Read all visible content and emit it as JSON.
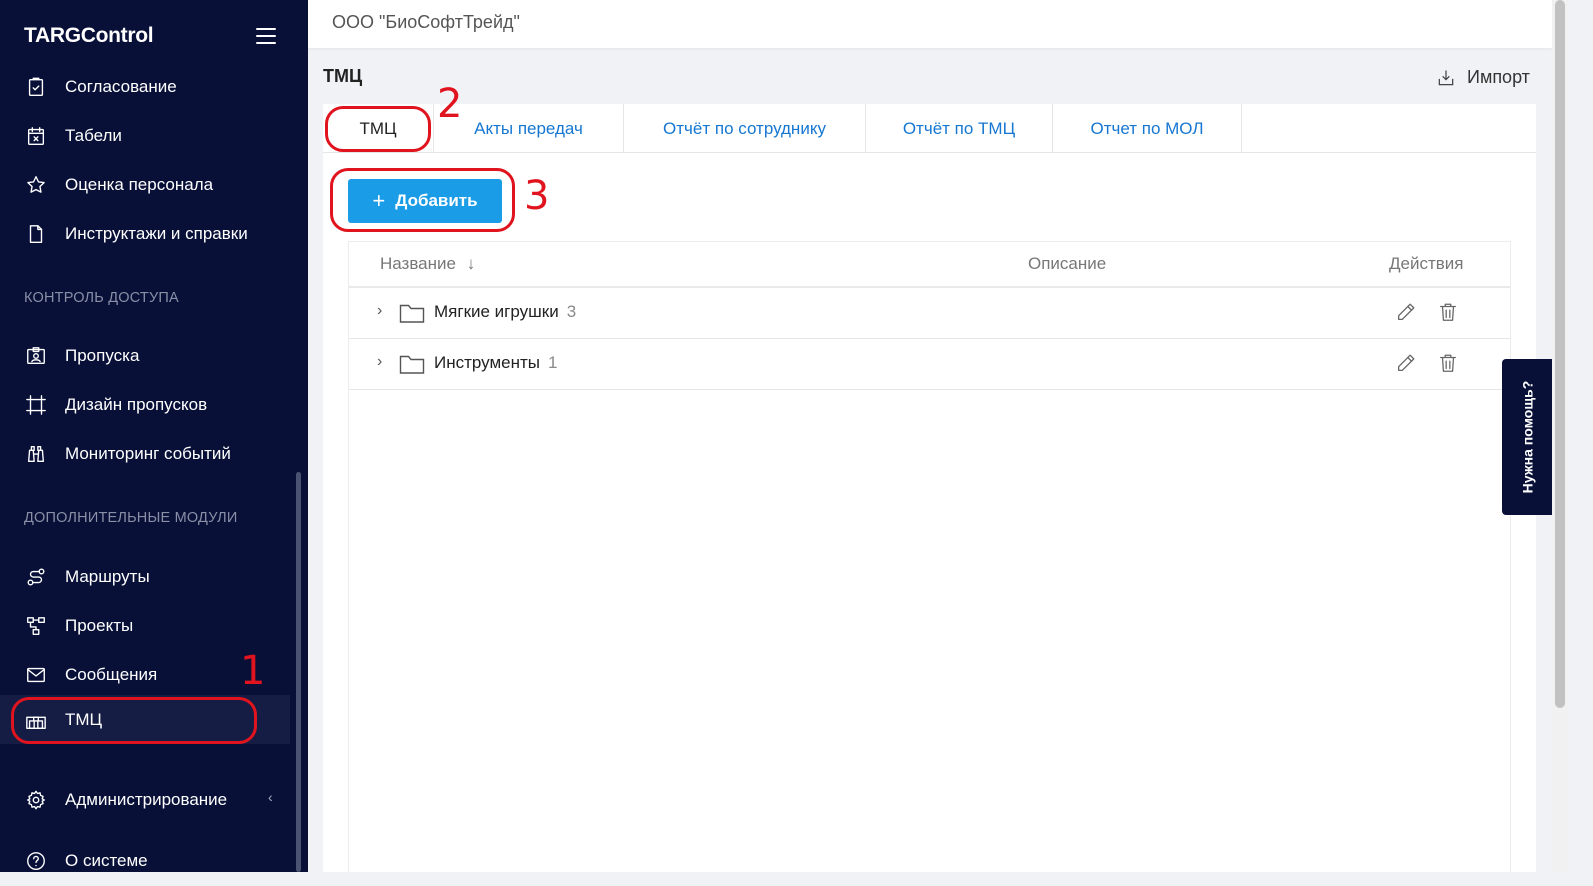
{
  "app": {
    "logo": "TARGControl"
  },
  "sidebar": {
    "items_main": [
      {
        "label": "Согласование",
        "icon": "clipboard-check-icon"
      },
      {
        "label": "Табели",
        "icon": "calendar-x-icon"
      },
      {
        "label": "Оценка персонала",
        "icon": "star-icon"
      },
      {
        "label": "Инструктажи и справки",
        "icon": "document-icon"
      }
    ],
    "section_access": "КОНТРОЛЬ ДОСТУПА",
    "items_access": [
      {
        "label": "Пропуска",
        "icon": "badge-icon"
      },
      {
        "label": "Дизайн пропусков",
        "icon": "frame-design-icon"
      },
      {
        "label": "Мониторинг событий",
        "icon": "binoculars-icon"
      }
    ],
    "section_modules": "ДОПОЛНИТЕЛЬНЫЕ МОДУЛИ",
    "items_modules": [
      {
        "label": "Маршруты",
        "icon": "route-icon"
      },
      {
        "label": "Проекты",
        "icon": "project-tree-icon"
      },
      {
        "label": "Сообщения",
        "icon": "envelope-icon"
      },
      {
        "label": "ТМЦ",
        "icon": "warehouse-icon",
        "active": true
      }
    ],
    "admin": {
      "label": "Администрирование",
      "icon": "gear-icon"
    },
    "about": {
      "label": "О системе",
      "icon": "question-circle-icon"
    }
  },
  "topbar": {
    "org": "ООО \"БиоСофтТрейд\""
  },
  "page": {
    "title": "ТМЦ",
    "import_label": "Импорт"
  },
  "tabs": [
    {
      "label": "ТМЦ",
      "active": true
    },
    {
      "label": "Акты передач"
    },
    {
      "label": "Отчёт по сотруднику"
    },
    {
      "label": "Отчёт по ТМЦ"
    },
    {
      "label": "Отчет по МОЛ"
    }
  ],
  "toolbar": {
    "add_label": "Добавить"
  },
  "table": {
    "columns": {
      "name": "Название",
      "sort_arrow": "↓",
      "description": "Описание",
      "actions": "Действия"
    },
    "rows": [
      {
        "name": "Мягкие игрушки",
        "count": "3",
        "description": ""
      },
      {
        "name": "Инструменты",
        "count": "1",
        "description": ""
      }
    ]
  },
  "help": {
    "label": "Нужна помощь?"
  },
  "annotations": {
    "one": "1",
    "two": "2",
    "three": "3"
  },
  "colors": {
    "sidebar_bg": "#081038",
    "accent": "#1a9ce6",
    "link": "#1677d2",
    "annotation": "#e0141e"
  }
}
